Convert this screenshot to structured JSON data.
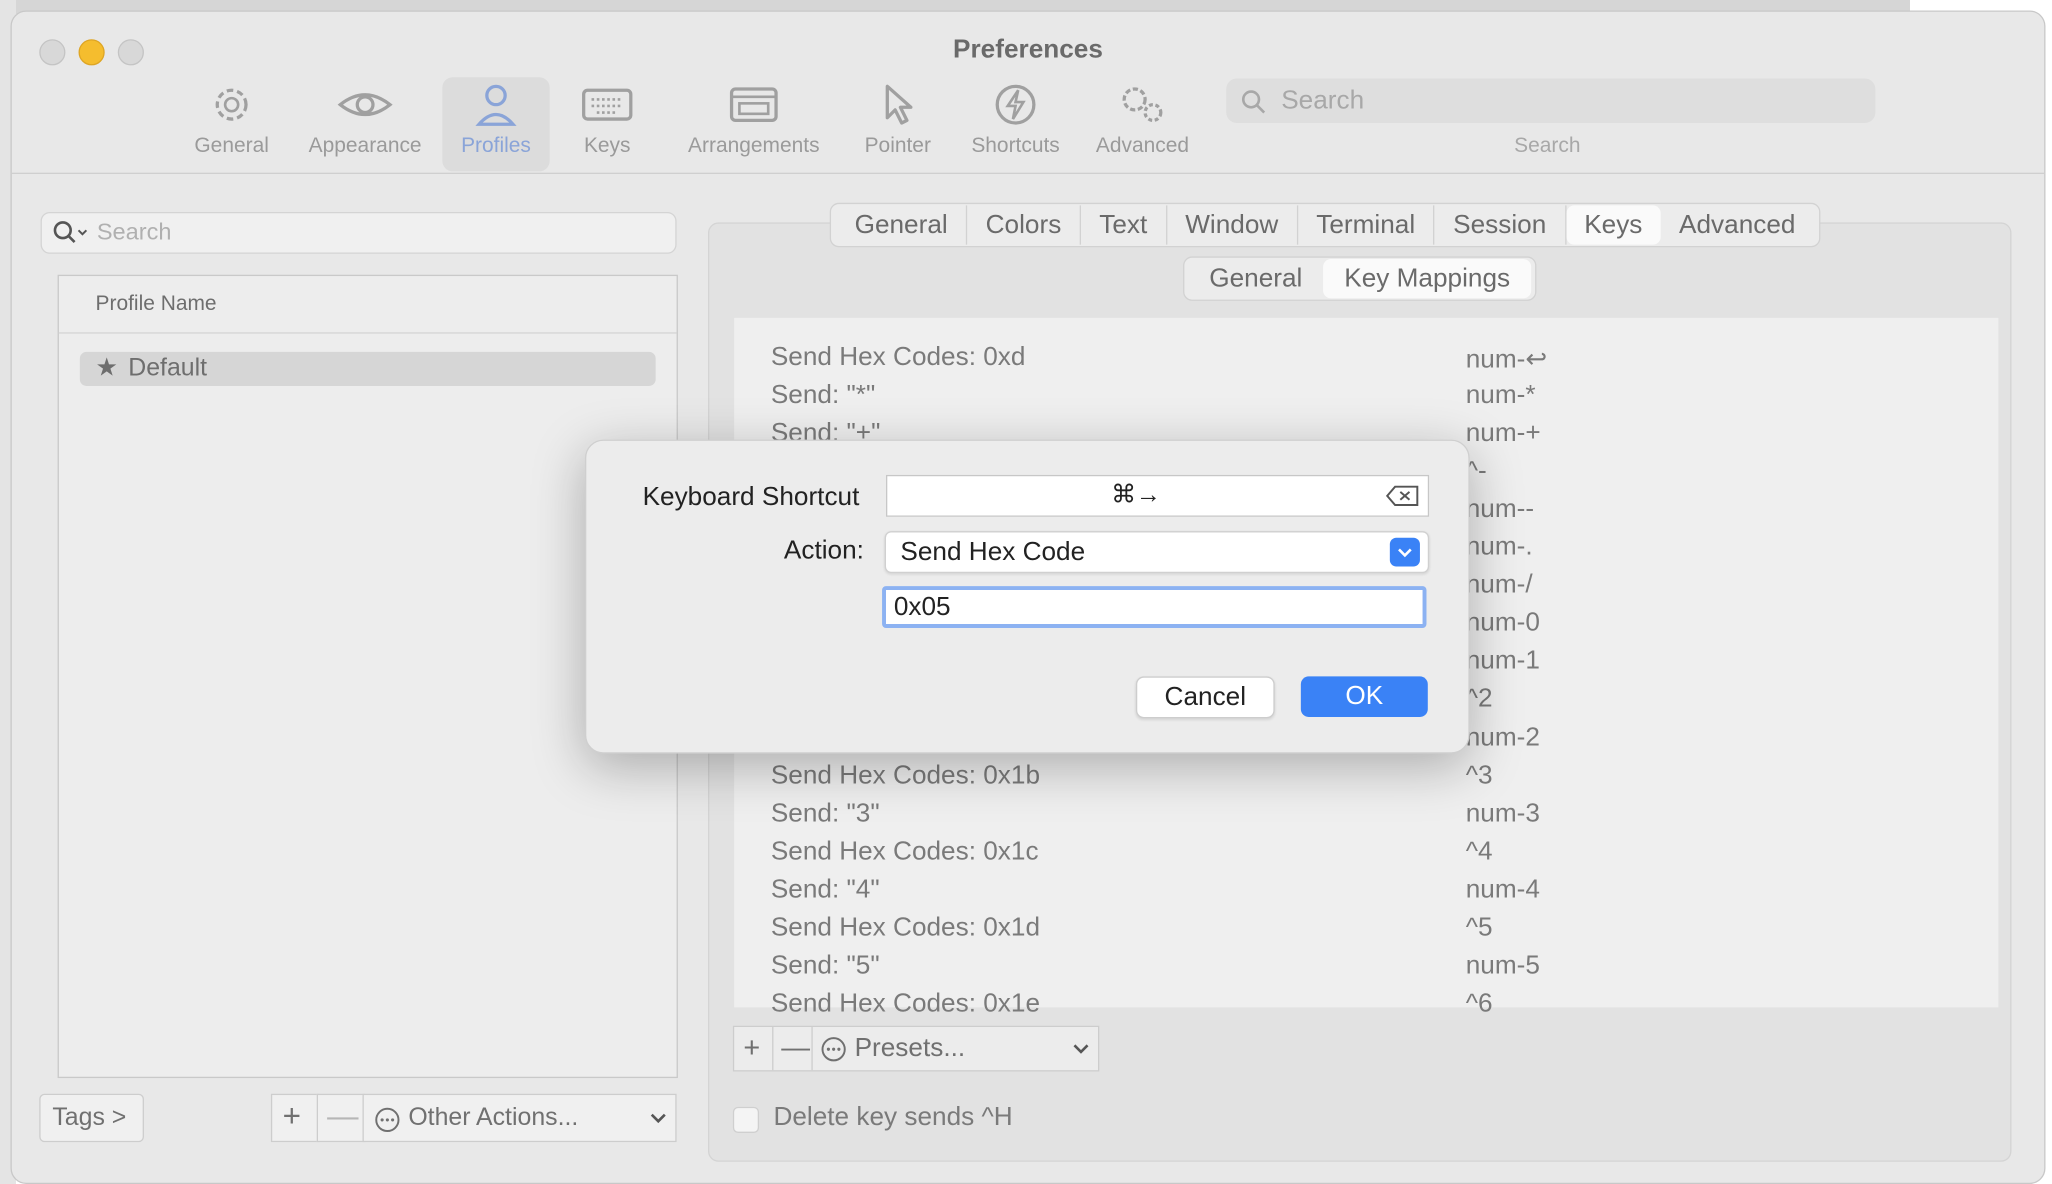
{
  "window": {
    "title": "Preferences"
  },
  "toolbar": {
    "items": [
      {
        "label": "General",
        "icon": "gear-icon"
      },
      {
        "label": "Appearance",
        "icon": "eye-icon"
      },
      {
        "label": "Profiles",
        "icon": "person-icon",
        "selected": true
      },
      {
        "label": "Keys",
        "icon": "keyboard-icon"
      },
      {
        "label": "Arrangements",
        "icon": "window-icon"
      },
      {
        "label": "Pointer",
        "icon": "cursor-icon"
      },
      {
        "label": "Shortcuts",
        "icon": "bolt-icon"
      },
      {
        "label": "Advanced",
        "icon": "gears-icon"
      }
    ],
    "search_placeholder": "Search",
    "search_label": "Search"
  },
  "profiles": {
    "search_placeholder": "Search",
    "column_header": "Profile Name",
    "items": [
      {
        "name": "Default",
        "star": "★"
      }
    ],
    "tags_label": "Tags >",
    "add_symbol": "+",
    "remove_symbol": "—",
    "other_actions_label": "Other Actions..."
  },
  "tabs": [
    "General",
    "Colors",
    "Text",
    "Window",
    "Terminal",
    "Session",
    "Keys",
    "Advanced"
  ],
  "active_tab": "Keys",
  "subtabs": [
    "General",
    "Key Mappings"
  ],
  "active_subtab": "Key Mappings",
  "mappings": [
    {
      "action": "Send Hex Codes: 0xd",
      "key": "num-↩"
    },
    {
      "action": "Send: \"*\"",
      "key": "num-*"
    },
    {
      "action": "Send: \"+\"",
      "key": "num-+"
    },
    {
      "action": "",
      "key": "^-"
    },
    {
      "action": "",
      "key": "num--"
    },
    {
      "action": "",
      "key": "num-."
    },
    {
      "action": "",
      "key": "num-/"
    },
    {
      "action": "",
      "key": "num-0"
    },
    {
      "action": "",
      "key": "num-1"
    },
    {
      "action": "",
      "key": "^2"
    },
    {
      "action": "",
      "key": "num-2"
    },
    {
      "action": "Send Hex Codes: 0x1b",
      "key": "^3"
    },
    {
      "action": "Send: \"3\"",
      "key": "num-3"
    },
    {
      "action": "Send Hex Codes: 0x1c",
      "key": "^4"
    },
    {
      "action": "Send: \"4\"",
      "key": "num-4"
    },
    {
      "action": "Send Hex Codes: 0x1d",
      "key": "^5"
    },
    {
      "action": "Send: \"5\"",
      "key": "num-5"
    },
    {
      "action": "Send Hex Codes: 0x1e",
      "key": "^6"
    }
  ],
  "mapping_controls": {
    "add_symbol": "+",
    "remove_symbol": "—",
    "presets_label": "Presets..."
  },
  "delete_key_label": "Delete key sends ^H",
  "dialog": {
    "shortcut_label": "Keyboard Shortcut",
    "shortcut_value": "⌘→",
    "action_label": "Action:",
    "action_value": "Send Hex Code",
    "hex_value": "0x05",
    "cancel_label": "Cancel",
    "ok_label": "OK"
  },
  "colors": {
    "accent": "#3a82f6",
    "focus_ring": "#8cb2f2",
    "minimize": "#f5bd2e"
  }
}
